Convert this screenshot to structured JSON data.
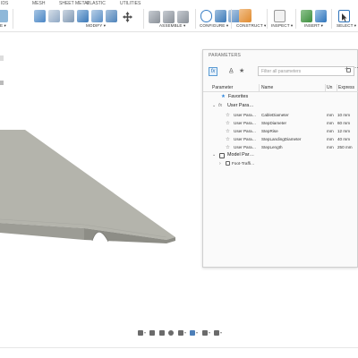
{
  "toolbar": {
    "tabs": [
      {
        "label": "IDS"
      },
      {
        "label": "MESH"
      },
      {
        "label": "SHEET METAL"
      },
      {
        "label": "PLASTIC"
      },
      {
        "label": "UTILITIES"
      }
    ],
    "groups": {
      "create_partial": "E ▾",
      "modify": "MODIFY ▾",
      "assemble": "ASSEMBLE ▾",
      "configure": "CONFIGURE ▾",
      "construct": "CONSTRUCT ▾",
      "inspect": "INSPECT ▾",
      "insert": "INSERT ▾",
      "select": "SELECT ▾"
    }
  },
  "dialog": {
    "title": "PARAMETERS",
    "filter_placeholder": "Filter all parameters",
    "add_icon": "+",
    "more_icon": "⋯",
    "columns": {
      "parameter": "Parameter",
      "name": "Name",
      "unit": "Un",
      "expression": "Express"
    },
    "favorites_label": "Favorites",
    "user_section_label": "User Para…",
    "user_params": [
      {
        "parameter": "User Para…",
        "name": "CableDiameter",
        "unit": "mm",
        "expression": "10 mm"
      },
      {
        "parameter": "User Para…",
        "name": "StepDiameter",
        "unit": "mm",
        "expression": "60 mm"
      },
      {
        "parameter": "User Para…",
        "name": "StepRise",
        "unit": "mm",
        "expression": "12 mm"
      },
      {
        "parameter": "User Para…",
        "name": "StepLandingDiameter",
        "unit": "mm",
        "expression": "40 mm"
      },
      {
        "parameter": "User Para…",
        "name": "StepLength",
        "unit": "mm",
        "expression": "250 mm"
      }
    ],
    "model_section_label": "Model Par…",
    "model_child_label": "Foot-Traffi…"
  },
  "colors": {
    "accent": "#2e73b8",
    "model_top": "#b3b3ab",
    "model_side": "#9a9a93",
    "star": "#2e86de"
  }
}
